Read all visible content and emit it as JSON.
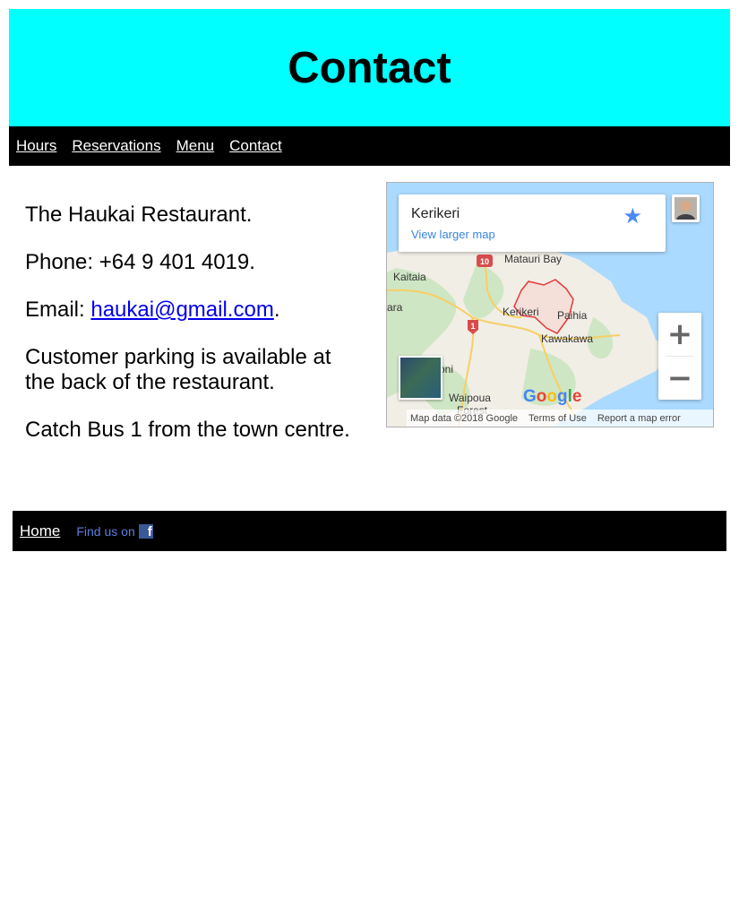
{
  "header": {
    "title": "Contact"
  },
  "nav": {
    "items": [
      "Hours",
      "Reservations",
      "Menu",
      "Contact"
    ]
  },
  "content": {
    "name": "The Haukai Restaurant.",
    "phone": "Phone: +64 9 401 4019.",
    "email_prefix": "Email: ",
    "email": "haukai@gmail.com",
    "email_suffix": ".",
    "parking": "Customer parking is available at the back of the restaurant.",
    "bus": "Catch Bus 1 from the town centre."
  },
  "map": {
    "place_name": "Kerikeri",
    "larger_map_link": "View larger map",
    "zoom_in": "+",
    "zoom_out": "−",
    "labels": {
      "matauri_bay": "Matauri Bay",
      "kaitaia": "Kaitaia",
      "kerikeri": "Kerikeri",
      "paihia": "Paihia",
      "kawakawa": "Kawakawa",
      "waipoua": "Waipoua",
      "forest": "Forest",
      "dargaville_partial": "oni",
      "ara_partial": "ara"
    },
    "route_10": "10",
    "route_1": "1",
    "google_logo": "Google",
    "footer": {
      "data": "Map data ©2018 Google",
      "terms": "Terms of Use",
      "report": "Report a map error"
    },
    "icons": [
      "star-icon",
      "avatar-icon",
      "satellite-thumbnail"
    ]
  },
  "footer": {
    "home": "Home",
    "find_us": "Find us on",
    "facebook_letter": "f"
  },
  "colors": {
    "header_bg": "#00ffff",
    "nav_bg": "#000000",
    "link": "#0000ee",
    "map_water": "#aadaff",
    "map_land": "#f1eee6",
    "facebook": "#3b5998"
  }
}
